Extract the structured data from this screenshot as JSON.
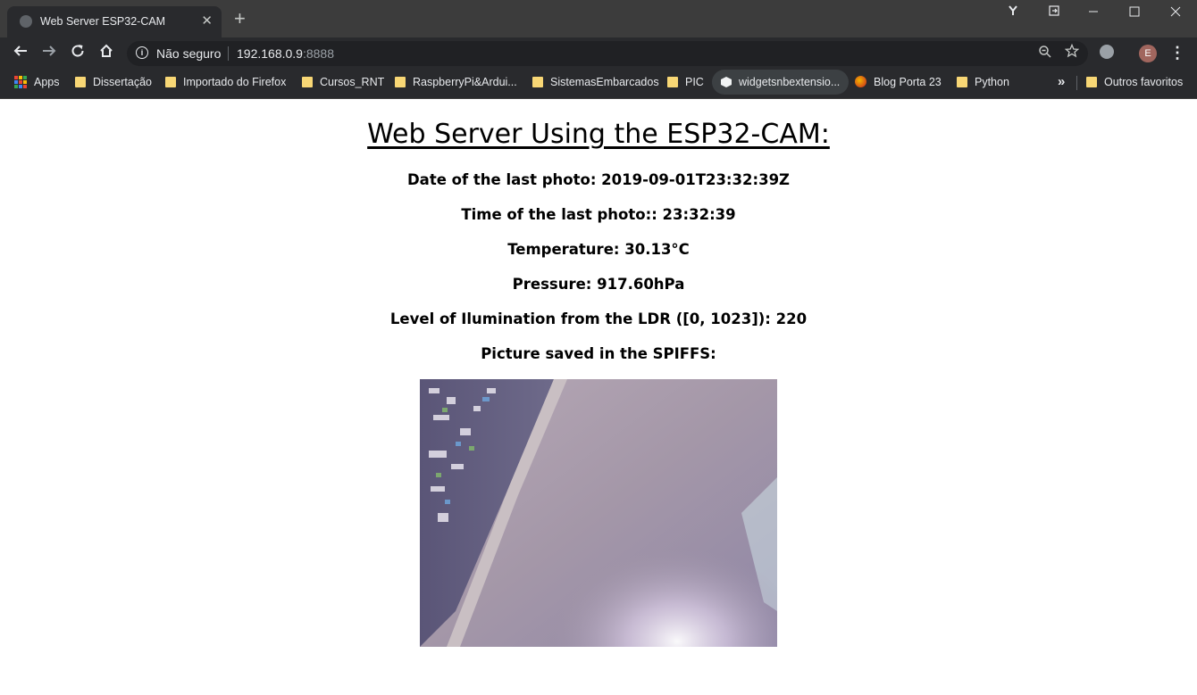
{
  "browser": {
    "tab_title": "Web Server ESP32-CAM",
    "tab_close": "✕",
    "new_tab": "+",
    "security_label": "Não seguro",
    "url_host": "192.168.0.9",
    "url_port": ":8888",
    "avatar_letter": "E",
    "bookmarks": [
      {
        "label": "Apps",
        "icon": "apps-grid-icon"
      },
      {
        "label": "Dissertação",
        "icon": "folder-icon"
      },
      {
        "label": "Importado do Firefox",
        "icon": "folder-icon"
      },
      {
        "label": "Cursos_RNT",
        "icon": "folder-icon"
      },
      {
        "label": "RaspberryPi&Ardui...",
        "icon": "folder-icon"
      },
      {
        "label": "SistemasEmbarcados",
        "icon": "folder-icon"
      },
      {
        "label": "PIC",
        "icon": "folder-icon"
      },
      {
        "label": "widgetsnbextensio...",
        "icon": "cube-icon"
      },
      {
        "label": "Blog Porta 23",
        "icon": "globe-icon"
      },
      {
        "label": "Python",
        "icon": "folder-icon"
      }
    ],
    "bookmarks_overflow": "»",
    "other_bookmarks": "Outros favoritos"
  },
  "page": {
    "heading": "Web Server Using the ESP32-CAM:",
    "date_line": "Date of the last photo: 2019-09-01T23:32:39Z",
    "time_line": "Time of the last photo:: 23:32:39",
    "temperature_line": "Temperature: 30.13°C",
    "pressure_line": "Pressure: 917.60hPa",
    "light_line": "Level of Ilumination from the LDR ([0, 1023]): 220",
    "picture_line": "Picture saved in the SPIFFS:"
  }
}
